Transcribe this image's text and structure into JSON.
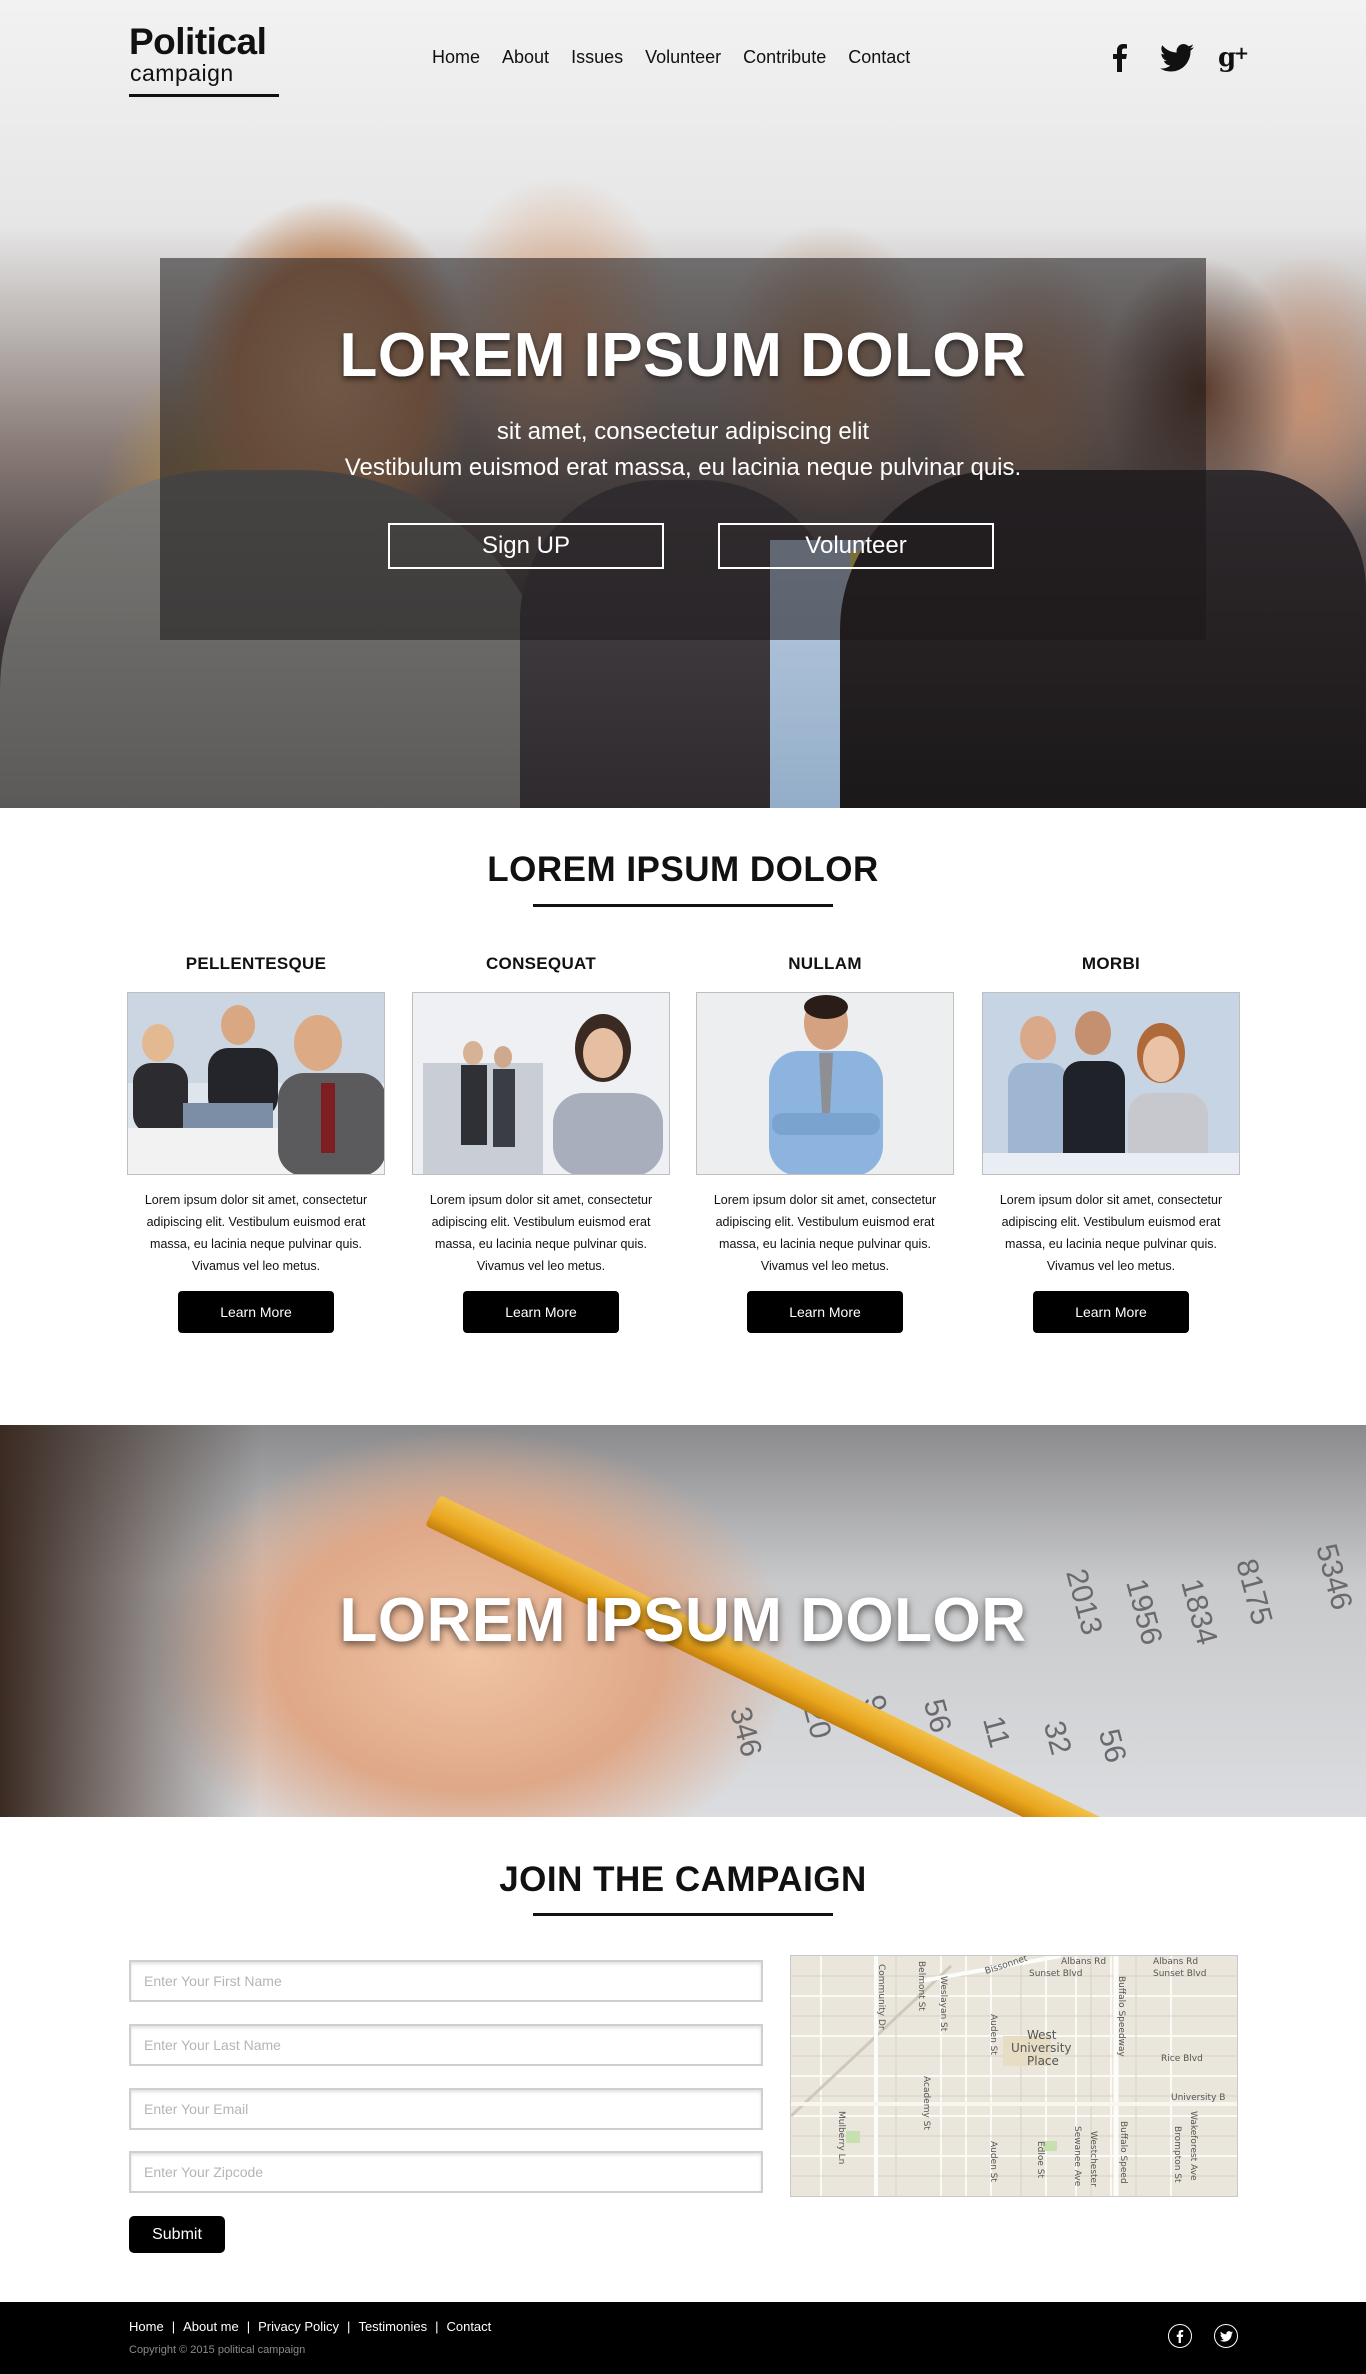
{
  "logo": {
    "title": "Political",
    "subtitle": "campaign"
  },
  "nav": {
    "items": [
      "Home",
      "About",
      "Issues",
      "Volunteer",
      "Contribute",
      "Contact"
    ]
  },
  "social": {
    "icons": [
      "facebook-icon",
      "twitter-icon",
      "google-plus-icon"
    ]
  },
  "hero": {
    "title": "LOREM IPSUM DOLOR",
    "subtitle1": "sit amet, consectetur adipiscing elit",
    "subtitle2": "Vestibulum euismod erat massa, eu lacinia neque pulvinar quis.",
    "signup_label": "Sign UP",
    "volunteer_label": "Volunteer"
  },
  "features": {
    "title": "LOREM IPSUM DOLOR",
    "cards": [
      {
        "title": "PELLENTESQUE",
        "text": "Lorem ipsum dolor sit amet, consectetur adipiscing elit. Vestibulum euismod erat massa, eu lacinia neque pulvinar quis. Vivamus vel leo metus.",
        "button": "Learn More"
      },
      {
        "title": "CONSEQUAT",
        "text": "Lorem ipsum dolor sit amet, consectetur adipiscing elit. Vestibulum euismod erat massa, eu lacinia neque pulvinar quis. Vivamus vel leo metus.",
        "button": "Learn More"
      },
      {
        "title": "NULLAM",
        "text": "Lorem ipsum dolor sit amet, consectetur adipiscing elit. Vestibulum euismod erat massa, eu lacinia neque pulvinar quis. Vivamus vel leo metus.",
        "button": "Learn More"
      },
      {
        "title": "MORBI",
        "text": "Lorem ipsum dolor sit amet, consectetur adipiscing elit. Vestibulum euismod erat massa, eu lacinia neque pulvinar quis. Vivamus vel leo metus.",
        "button": "Learn More"
      }
    ]
  },
  "band": {
    "title": "LOREM IPSUM DOLOR",
    "numbers": [
      "346",
      "20",
      "91",
      "56",
      "11",
      "32",
      "56",
      "1956",
      "1834",
      "8175",
      "5346",
      "2013"
    ]
  },
  "join": {
    "title": "JOIN THE CAMPAIGN",
    "first_name_placeholder": "Enter Your First Name",
    "last_name_placeholder": "Enter Your Last Name",
    "email_placeholder": "Enter Your Email",
    "zipcode_placeholder": "Enter Your Zipcode",
    "submit_label": "Submit"
  },
  "map": {
    "labels": [
      "Bissonnet",
      "Albans Rd",
      "Sunset Blvd",
      "Albans Rd",
      "Sunset Blvd",
      "Community Dr",
      "Belmont St",
      "Weslayan St",
      "Auden St",
      "West",
      "University",
      "Place",
      "Buffalo Speedway",
      "Rice Blvd",
      "University B",
      "Academy St",
      "Mulberry Ln",
      "Auden St",
      "Edloe St",
      "Sewanee Ave",
      "Westchester",
      "Buffalo Speed",
      "Wakeforest Ave",
      "Brompton St"
    ]
  },
  "footer": {
    "links": [
      "Home",
      "About me",
      "Privacy Policy",
      "Testimonies",
      "Contact"
    ],
    "separator": "|",
    "copyright": "Copyright © 2015 political campaign",
    "social": [
      "facebook-icon",
      "twitter-icon"
    ]
  },
  "colors": {
    "accent": "#000000",
    "hero_overlay": "#1c181a",
    "footer_bg": "#000000"
  }
}
